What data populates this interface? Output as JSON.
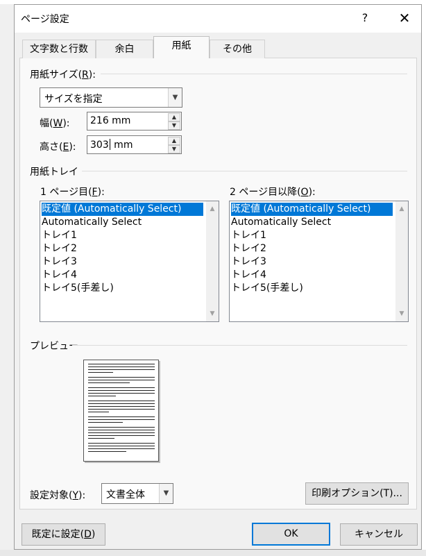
{
  "dialog": {
    "title": "ページ設定",
    "help_label": "?",
    "close_label": "✕"
  },
  "tabs": [
    {
      "label": "文字数と行数"
    },
    {
      "label": "余白"
    },
    {
      "label": "用紙"
    },
    {
      "label": "その他"
    }
  ],
  "paper_size": {
    "section_prefix": "用紙サイズ(",
    "section_key": "R",
    "section_suffix": "):",
    "selected": "サイズを指定",
    "width_label_prefix": "幅(",
    "width_key": "W",
    "width_label_suffix": "):",
    "width_value": "216 mm",
    "height_label_prefix": "高さ(",
    "height_key": "E",
    "height_label_suffix": "):",
    "height_value_before": "303",
    "height_value_after": " mm"
  },
  "paper_tray": {
    "section_label": "用紙トレイ",
    "first_page_prefix": "1 ページ目(",
    "first_page_key": "F",
    "first_page_suffix": "):",
    "other_pages_prefix": "2 ページ目以降(",
    "other_pages_key": "O",
    "other_pages_suffix": "):",
    "first_page_items": [
      "既定値 (Automatically Select)",
      "Automatically Select",
      "トレイ1",
      "トレイ2",
      "トレイ3",
      "トレイ4",
      "トレイ5(手差し)"
    ],
    "other_pages_items": [
      "既定値 (Automatically Select)",
      "Automatically Select",
      "トレイ1",
      "トレイ2",
      "トレイ3",
      "トレイ4",
      "トレイ5(手差し)"
    ]
  },
  "preview": {
    "section_label": "プレビュー"
  },
  "apply_to": {
    "label_prefix": "設定対象(",
    "label_key": "Y",
    "label_suffix": "):",
    "selected": "文書全体"
  },
  "buttons": {
    "print_options": "印刷オプション(T)...",
    "set_default_prefix": "既定に設定(",
    "set_default_key": "D",
    "set_default_suffix": ")",
    "ok": "OK",
    "cancel": "キャンセル"
  }
}
